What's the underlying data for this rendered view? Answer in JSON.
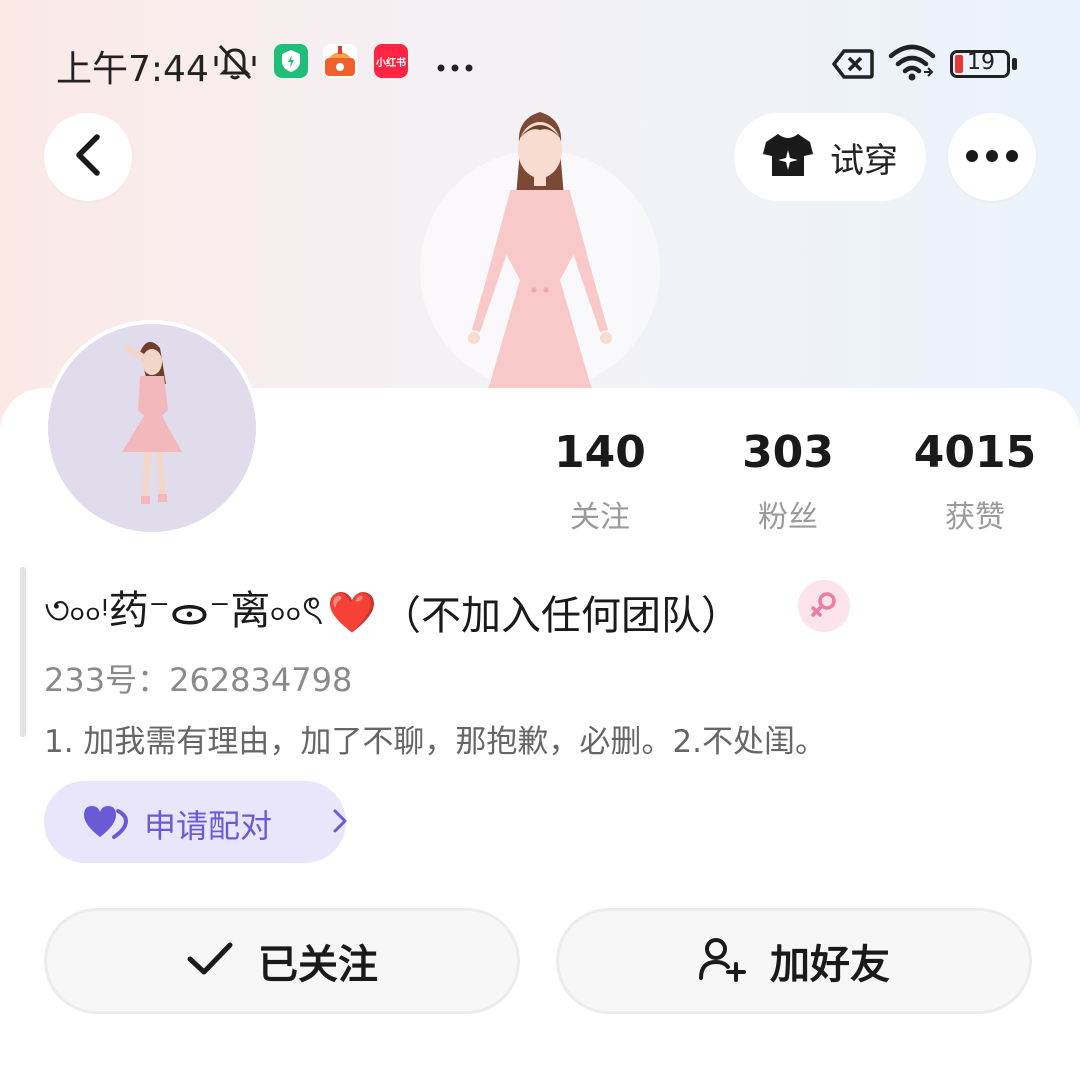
{
  "status_bar": {
    "time": "上午7:44",
    "battery": "19",
    "icons": [
      "mute-icon",
      "shield-app-icon",
      "cake-app-icon",
      "xiaohongshu-app-icon",
      "more-dots-icon",
      "no-sim-icon",
      "wifi-icon",
      "battery-icon"
    ],
    "app_badge_xhs": "小红书"
  },
  "header": {
    "back_icon": "chevron-left-icon",
    "tryon_label": "试穿",
    "tryon_icon": "tshirt-sparkle-icon",
    "more_icon": "more-dots-icon"
  },
  "profile": {
    "stats": [
      {
        "value": "140",
        "label": "关注"
      },
      {
        "value": "303",
        "label": "粉丝"
      },
      {
        "value": "4015",
        "label": "获赞"
      }
    ],
    "nickname_prefix": "৩৹৹ᵎ药⁻ᯣ⁻离৹৹ৎ",
    "nickname_heart": "❤️",
    "nickname_suffix": "（不加入任何团队）",
    "gender": "female",
    "account_id": "233号：262834798",
    "bio": "1. 加我需有理由，加了不聊，那抱歉，必删。2.不处闺。"
  },
  "pair_button": {
    "label": "申请配对",
    "icon": "double-heart-icon"
  },
  "actions": {
    "following_label": "已关注",
    "add_friend_label": "加好友"
  },
  "colors": {
    "accent_purple": "#6a5ad6",
    "pair_bg": "#e9e6fb",
    "gender_pink": "#f07aa0",
    "battery_red": "#e53935"
  }
}
